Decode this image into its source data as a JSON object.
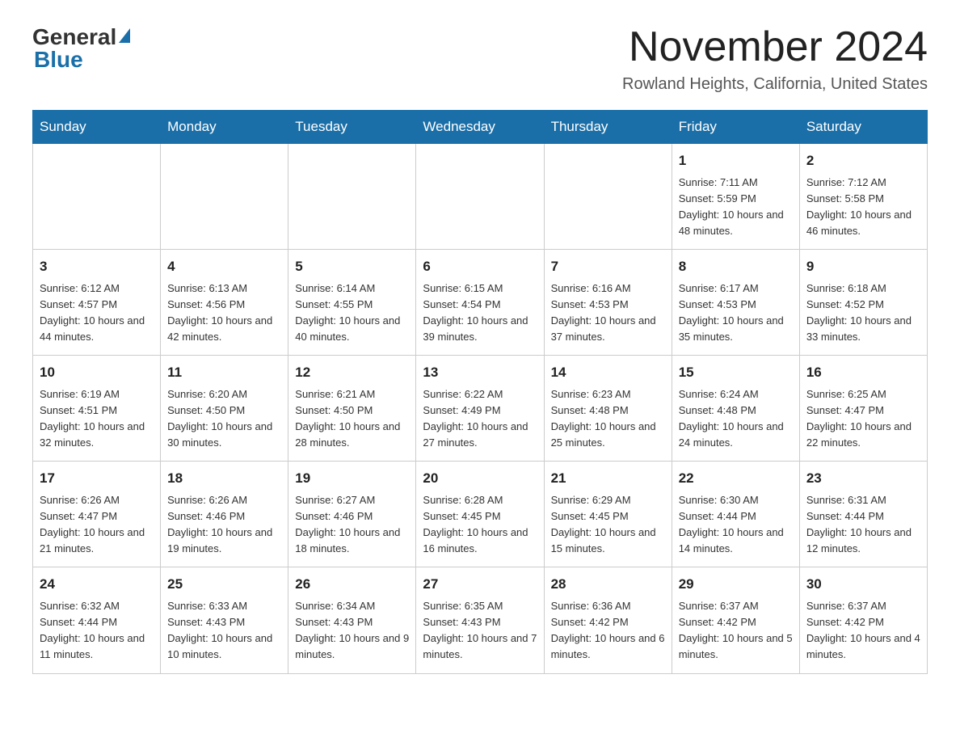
{
  "logo": {
    "general": "General",
    "blue": "Blue"
  },
  "header": {
    "month": "November 2024",
    "location": "Rowland Heights, California, United States"
  },
  "days_of_week": [
    "Sunday",
    "Monday",
    "Tuesday",
    "Wednesday",
    "Thursday",
    "Friday",
    "Saturday"
  ],
  "weeks": [
    [
      {
        "day": "",
        "info": ""
      },
      {
        "day": "",
        "info": ""
      },
      {
        "day": "",
        "info": ""
      },
      {
        "day": "",
        "info": ""
      },
      {
        "day": "",
        "info": ""
      },
      {
        "day": "1",
        "info": "Sunrise: 7:11 AM\nSunset: 5:59 PM\nDaylight: 10 hours and 48 minutes."
      },
      {
        "day": "2",
        "info": "Sunrise: 7:12 AM\nSunset: 5:58 PM\nDaylight: 10 hours and 46 minutes."
      }
    ],
    [
      {
        "day": "3",
        "info": "Sunrise: 6:12 AM\nSunset: 4:57 PM\nDaylight: 10 hours and 44 minutes."
      },
      {
        "day": "4",
        "info": "Sunrise: 6:13 AM\nSunset: 4:56 PM\nDaylight: 10 hours and 42 minutes."
      },
      {
        "day": "5",
        "info": "Sunrise: 6:14 AM\nSunset: 4:55 PM\nDaylight: 10 hours and 40 minutes."
      },
      {
        "day": "6",
        "info": "Sunrise: 6:15 AM\nSunset: 4:54 PM\nDaylight: 10 hours and 39 minutes."
      },
      {
        "day": "7",
        "info": "Sunrise: 6:16 AM\nSunset: 4:53 PM\nDaylight: 10 hours and 37 minutes."
      },
      {
        "day": "8",
        "info": "Sunrise: 6:17 AM\nSunset: 4:53 PM\nDaylight: 10 hours and 35 minutes."
      },
      {
        "day": "9",
        "info": "Sunrise: 6:18 AM\nSunset: 4:52 PM\nDaylight: 10 hours and 33 minutes."
      }
    ],
    [
      {
        "day": "10",
        "info": "Sunrise: 6:19 AM\nSunset: 4:51 PM\nDaylight: 10 hours and 32 minutes."
      },
      {
        "day": "11",
        "info": "Sunrise: 6:20 AM\nSunset: 4:50 PM\nDaylight: 10 hours and 30 minutes."
      },
      {
        "day": "12",
        "info": "Sunrise: 6:21 AM\nSunset: 4:50 PM\nDaylight: 10 hours and 28 minutes."
      },
      {
        "day": "13",
        "info": "Sunrise: 6:22 AM\nSunset: 4:49 PM\nDaylight: 10 hours and 27 minutes."
      },
      {
        "day": "14",
        "info": "Sunrise: 6:23 AM\nSunset: 4:48 PM\nDaylight: 10 hours and 25 minutes."
      },
      {
        "day": "15",
        "info": "Sunrise: 6:24 AM\nSunset: 4:48 PM\nDaylight: 10 hours and 24 minutes."
      },
      {
        "day": "16",
        "info": "Sunrise: 6:25 AM\nSunset: 4:47 PM\nDaylight: 10 hours and 22 minutes."
      }
    ],
    [
      {
        "day": "17",
        "info": "Sunrise: 6:26 AM\nSunset: 4:47 PM\nDaylight: 10 hours and 21 minutes."
      },
      {
        "day": "18",
        "info": "Sunrise: 6:26 AM\nSunset: 4:46 PM\nDaylight: 10 hours and 19 minutes."
      },
      {
        "day": "19",
        "info": "Sunrise: 6:27 AM\nSunset: 4:46 PM\nDaylight: 10 hours and 18 minutes."
      },
      {
        "day": "20",
        "info": "Sunrise: 6:28 AM\nSunset: 4:45 PM\nDaylight: 10 hours and 16 minutes."
      },
      {
        "day": "21",
        "info": "Sunrise: 6:29 AM\nSunset: 4:45 PM\nDaylight: 10 hours and 15 minutes."
      },
      {
        "day": "22",
        "info": "Sunrise: 6:30 AM\nSunset: 4:44 PM\nDaylight: 10 hours and 14 minutes."
      },
      {
        "day": "23",
        "info": "Sunrise: 6:31 AM\nSunset: 4:44 PM\nDaylight: 10 hours and 12 minutes."
      }
    ],
    [
      {
        "day": "24",
        "info": "Sunrise: 6:32 AM\nSunset: 4:44 PM\nDaylight: 10 hours and 11 minutes."
      },
      {
        "day": "25",
        "info": "Sunrise: 6:33 AM\nSunset: 4:43 PM\nDaylight: 10 hours and 10 minutes."
      },
      {
        "day": "26",
        "info": "Sunrise: 6:34 AM\nSunset: 4:43 PM\nDaylight: 10 hours and 9 minutes."
      },
      {
        "day": "27",
        "info": "Sunrise: 6:35 AM\nSunset: 4:43 PM\nDaylight: 10 hours and 7 minutes."
      },
      {
        "day": "28",
        "info": "Sunrise: 6:36 AM\nSunset: 4:42 PM\nDaylight: 10 hours and 6 minutes."
      },
      {
        "day": "29",
        "info": "Sunrise: 6:37 AM\nSunset: 4:42 PM\nDaylight: 10 hours and 5 minutes."
      },
      {
        "day": "30",
        "info": "Sunrise: 6:37 AM\nSunset: 4:42 PM\nDaylight: 10 hours and 4 minutes."
      }
    ]
  ]
}
